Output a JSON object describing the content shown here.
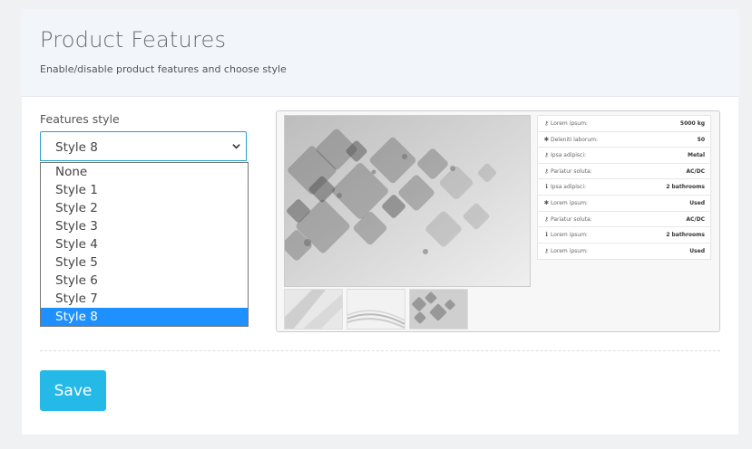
{
  "header": {
    "title": "Product Features",
    "subtitle": "Enable/disable product features and choose style"
  },
  "form": {
    "features_style_label": "Features style",
    "selected_value": "Style 8",
    "options": [
      "None",
      "Style 1",
      "Style 2",
      "Style 3",
      "Style 4",
      "Style 5",
      "Style 6",
      "Style 7",
      "Style 8"
    ],
    "highlighted_option": "Style 8",
    "save_label": "Save"
  },
  "preview": {
    "specs": [
      {
        "icon": "key-icon",
        "label": "Lorem ipsum:",
        "value": "5000 kg"
      },
      {
        "icon": "asterisk-icon",
        "label": "Deleniti laborum:",
        "value": "50"
      },
      {
        "icon": "key-icon",
        "label": "Ipsa adipisci:",
        "value": "Metal"
      },
      {
        "icon": "key-icon",
        "label": "Pariatur soluta:",
        "value": "AC/DC"
      },
      {
        "icon": "info-icon",
        "label": "Ipsa adipisci:",
        "value": "2 bathrooms"
      },
      {
        "icon": "asterisk-icon",
        "label": "Lorem ipsum:",
        "value": "Used"
      },
      {
        "icon": "key-icon",
        "label": "Pariatur soluta:",
        "value": "AC/DC"
      },
      {
        "icon": "info-icon",
        "label": "Lorem ipsum:",
        "value": "2 bathrooms"
      },
      {
        "icon": "key-icon",
        "label": "Lorem ipsum:",
        "value": "Used"
      }
    ]
  },
  "colors": {
    "accent": "#25b9e8",
    "option_highlight": "#1e90ff",
    "select_border": "#2a9fc8"
  }
}
